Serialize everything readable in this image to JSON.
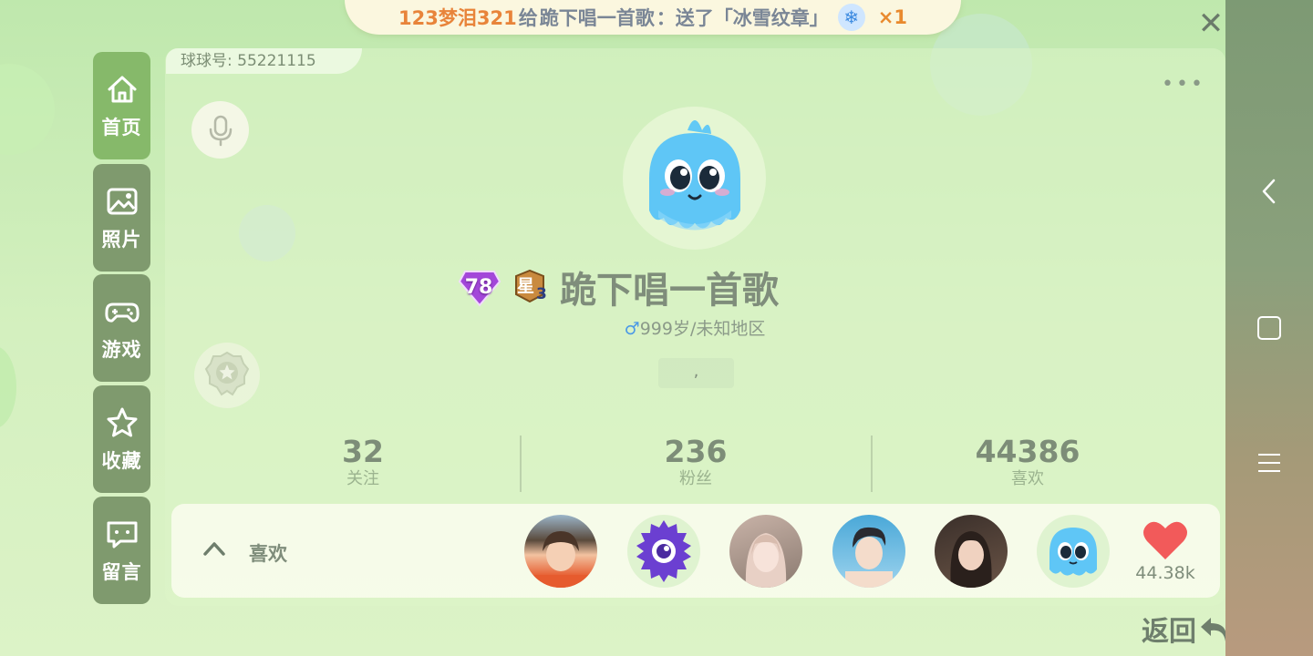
{
  "banner": {
    "sender": "123梦泪321",
    "action_prefix": "给",
    "receiver": "跪下唱一首歌",
    "action_suffix": "：送了「冰雪纹章」",
    "count": "×1",
    "gift_icon": "snowflake-icon"
  },
  "sidebar": {
    "items": [
      {
        "label": "首页",
        "icon": "home-icon",
        "active": true
      },
      {
        "label": "照片",
        "icon": "photo-icon",
        "active": false
      },
      {
        "label": "游戏",
        "icon": "gamepad-icon",
        "active": false
      },
      {
        "label": "收藏",
        "icon": "star-icon",
        "active": false
      },
      {
        "label": "留言",
        "icon": "message-icon",
        "active": false
      }
    ]
  },
  "profile": {
    "id_text": "球球号: 55221115",
    "level": "78",
    "star_level": "星",
    "star_number": "3",
    "name": "跪下唱一首歌",
    "gender_symbol": "♂",
    "age_region": "999岁/未知地区",
    "signature": ","
  },
  "stats": [
    {
      "value": "32",
      "label": "关注"
    },
    {
      "value": "236",
      "label": "粉丝"
    },
    {
      "value": "44386",
      "label": "喜欢"
    }
  ],
  "likes": {
    "label": "喜欢",
    "count": "44.38k"
  },
  "footer": {
    "back_label": "返回"
  },
  "colors": {
    "accent_green": "#86b96a",
    "tab_green": "#7f9a6e",
    "heart": "#f25a5a",
    "banner_orange": "#e98a2e"
  }
}
